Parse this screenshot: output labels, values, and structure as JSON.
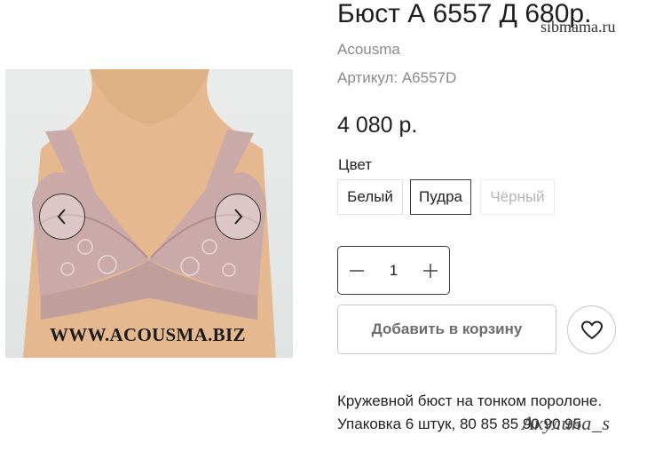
{
  "product": {
    "title": "Бюст А 6557 Д 680р.",
    "brand": "Acousma",
    "sku": "Артикул: А6557D",
    "price": "4 080 р.",
    "description_line1": "Кружевной бюст на тонком поролоне.",
    "description_line2": "Упаковка 6 штук, 80 85 85 90 90 95"
  },
  "gallery": {
    "watermark": "WWW.ACOUSMA.BIZ",
    "prev_icon": "chevron-left-icon",
    "next_icon": "chevron-right-icon"
  },
  "color": {
    "label": "Цвет",
    "options": [
      "Белый",
      "Пудра",
      "Чёрный"
    ],
    "selected": "Пудра",
    "unavailable": [
      "Чёрный"
    ]
  },
  "quantity": {
    "value": "1",
    "minus_icon": "minus-icon",
    "plus_icon": "plus-icon"
  },
  "actions": {
    "add_to_cart": "Добавить в корзину",
    "favorite_icon": "heart-icon"
  },
  "overlays": {
    "site_mark": "sibmama.ru",
    "signature": "Акулина_s"
  },
  "colors": {
    "text": "#222222",
    "muted": "#8a8a8a",
    "border": "#c7c7c7",
    "product_fabric": "#c9aaa8"
  }
}
